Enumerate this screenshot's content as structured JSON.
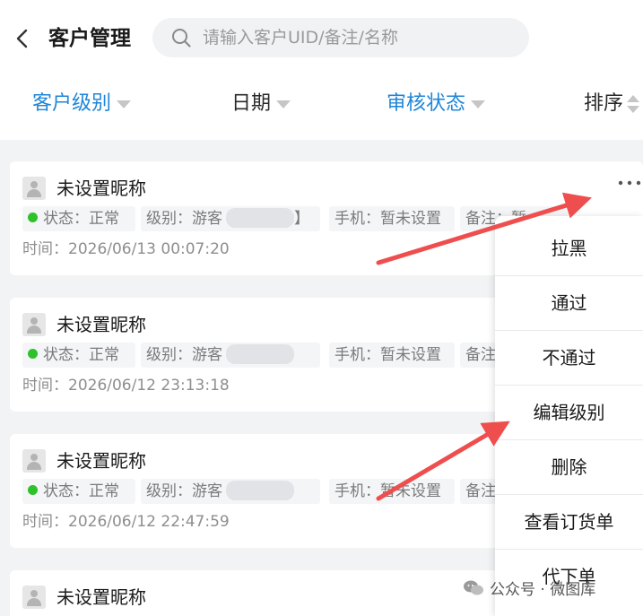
{
  "header": {
    "title": "客户管理",
    "search_placeholder": "请输入客户UID/备注/名称"
  },
  "filters": [
    {
      "label": "客户级别",
      "active": true
    },
    {
      "label": "日期",
      "active": false
    },
    {
      "label": "审核状态",
      "active": true
    },
    {
      "label": "排序",
      "active": false
    }
  ],
  "customers": [
    {
      "name": "未设置昵称",
      "status": "状态：正常",
      "level": "级别：游客",
      "level_suffix": "】",
      "phone": "手机：暂未设置",
      "remark": "备注",
      "remark_tail": "：暂",
      "time": "时间：2026/06/13 00:07:20"
    },
    {
      "name": "未设置昵称",
      "status": "状态：正常",
      "level": "级别：游客",
      "phone": "手机：暂未设置",
      "remark": "备注",
      "time": "时间：2026/06/12 23:13:18"
    },
    {
      "name": "未设置昵称",
      "status": "状态：正常",
      "level": "级别：游客",
      "phone": "手机：暂未设置",
      "remark": "备注",
      "time": "时间：2026/06/12 22:47:59"
    },
    {
      "name": "未设置昵称"
    }
  ],
  "more_label": "···",
  "menu": [
    "拉黑",
    "通过",
    "不通过",
    "编辑级别",
    "删除",
    "查看订货单",
    "代下单"
  ],
  "watermark": "公众号 · 微图库",
  "colors": {
    "accent": "#1f86d8",
    "status_green": "#2ec12a",
    "arrow": "#ee4e4e"
  }
}
